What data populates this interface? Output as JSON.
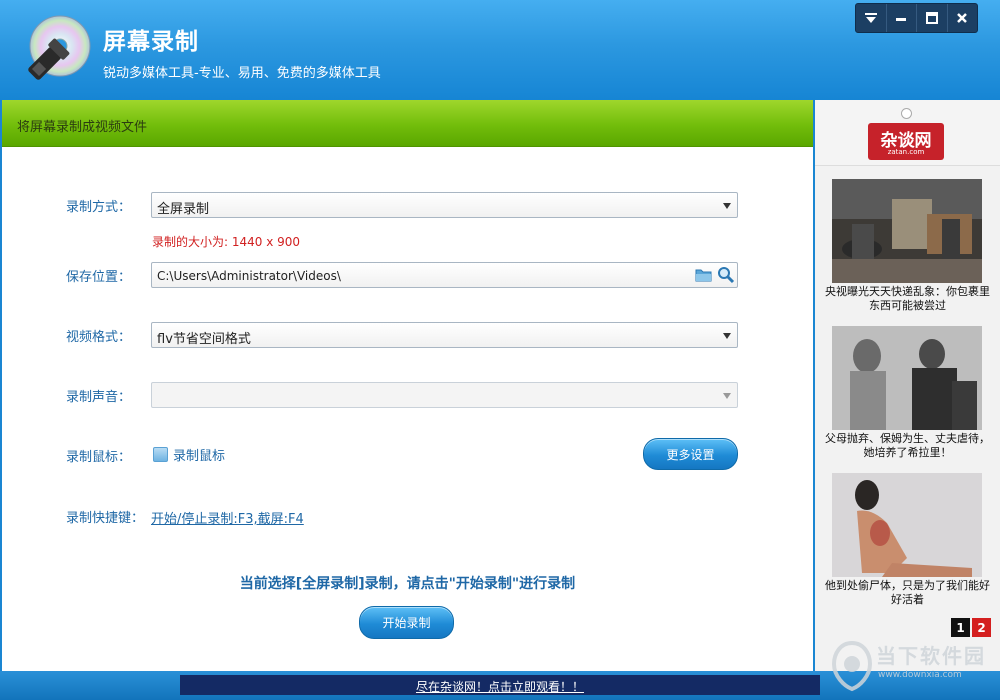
{
  "app": {
    "title": "屏幕录制",
    "subtitle": "锐动多媒体工具-专业、易用、免费的多媒体工具"
  },
  "window_controls": [
    "menu-icon",
    "minimize-icon",
    "maximize-icon",
    "close-icon"
  ],
  "section_title": "将屏幕录制成视频文件",
  "form": {
    "mode_label": "录制方式：",
    "mode_value": "全屏录制",
    "size_info": "录制的大小为: 1440 x 900",
    "path_label": "保存位置：",
    "path_value": "C:\\Users\\Administrator\\Videos\\",
    "format_label": "视频格式：",
    "format_value": "flv节省空间格式",
    "audio_label": "录制声音：",
    "audio_value": "",
    "mouse_label": "录制鼠标：",
    "mouse_checkbox_label": "录制鼠标",
    "mouse_checked": false,
    "more_settings": "更多设置",
    "hotkey_label": "录制快捷键：",
    "hotkey_value": "开始/停止录制:F3,截屏:F4"
  },
  "prompt": "当前选择[全屏录制]录制，请点击\"开始录制\"进行录制",
  "start_button": "开始录制",
  "side": {
    "brand": "杂谈网",
    "brand_url": "zatan.com",
    "items": [
      {
        "caption": "央视曝光天天快递乱象：你包裹里东西可能被尝过"
      },
      {
        "caption": "父母抛弃、保姆为生、丈夫虐待，她培养了希拉里！"
      },
      {
        "caption": "他到处偷尸体，只是为了我们能好好活着"
      }
    ],
    "pages": [
      "1",
      "2"
    ]
  },
  "marquee": "尽在杂谈网！点击立即观看！！",
  "watermark": {
    "text": "当下软件园",
    "url": "www.downxia.com"
  },
  "colors": {
    "header_blue": "#2c98e0",
    "green_bar": "#72bd0b",
    "label_blue": "#1f68a6",
    "size_red": "#d12121",
    "brand_red": "#c6222a"
  }
}
